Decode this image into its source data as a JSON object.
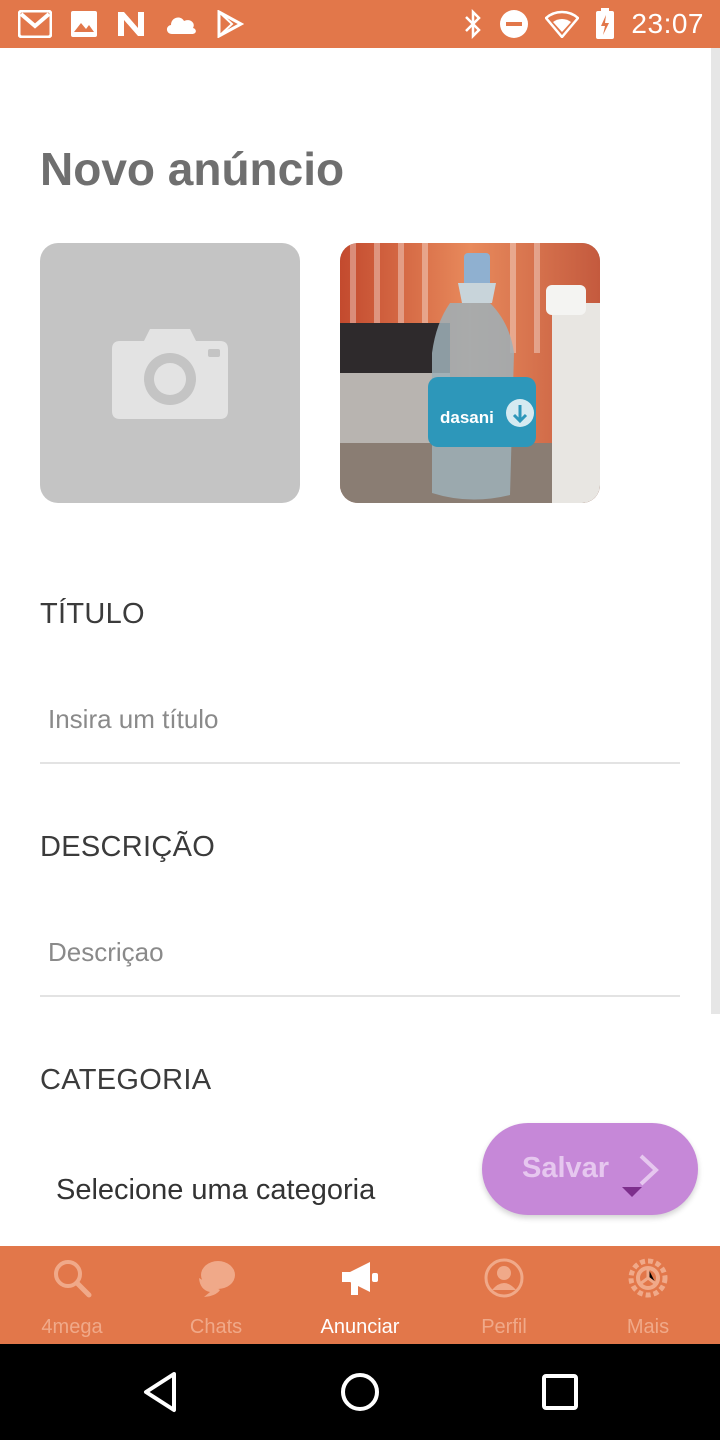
{
  "status_bar": {
    "time": "23:07",
    "left_icons": [
      "gmail-icon",
      "image-icon",
      "n-app-icon",
      "cloud-icon",
      "play-store-icon"
    ],
    "right_icons": [
      "bluetooth-icon",
      "do-not-disturb-icon",
      "wifi-icon",
      "battery-charging-icon"
    ]
  },
  "page": {
    "title": "Novo anúncio"
  },
  "photos": [
    {
      "type": "empty",
      "icon": "camera-icon"
    },
    {
      "type": "filled",
      "description": "photo"
    }
  ],
  "form": {
    "title_label": "TÍTULO",
    "title_placeholder": "Insira um título",
    "description_label": "DESCRIÇÃO",
    "description_placeholder": "Descriçao",
    "category_label": "CATEGORIA",
    "category_select": "Selecione uma categoria"
  },
  "fab": {
    "label": "Salvar"
  },
  "bottom_nav": {
    "items": [
      {
        "label": "4mega",
        "icon": "search-icon",
        "active": false
      },
      {
        "label": "Chats",
        "icon": "chat-icon",
        "active": false
      },
      {
        "label": "Anunciar",
        "icon": "megaphone-icon",
        "active": true
      },
      {
        "label": "Perfil",
        "icon": "profile-icon",
        "active": false
      },
      {
        "label": "Mais",
        "icon": "settings-icon",
        "active": false
      }
    ]
  },
  "colors": {
    "accent": "#E2774A",
    "fab": "#C688D8",
    "placeholder_photo": "#C4C4C4"
  }
}
